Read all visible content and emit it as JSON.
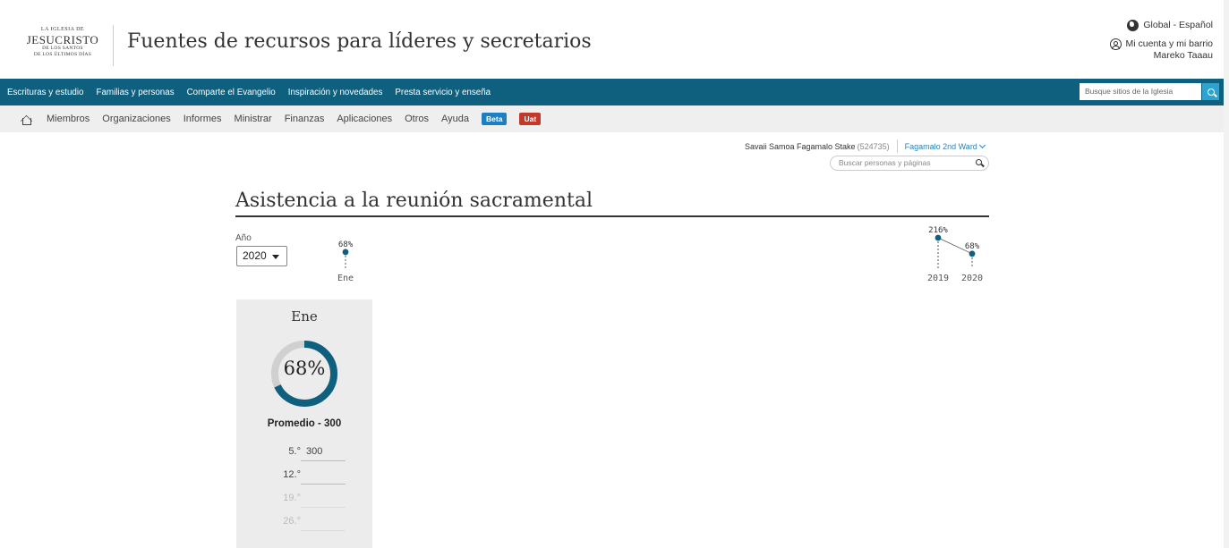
{
  "header": {
    "logo_lines": [
      "LA IGLESIA DE",
      "JESUCRISTO",
      "DE LOS SANTOS",
      "DE LOS ÚLTIMOS DÍAS"
    ],
    "site_title": "Fuentes de recursos para líderes y secretarios",
    "language": "Global - Español",
    "account_label": "Mi cuenta y mi barrio",
    "user_name": "Mareko Taaau"
  },
  "main_nav": {
    "items": [
      "Escrituras y estudio",
      "Familias y personas",
      "Comparte el Evangelio",
      "Inspiración y novedades",
      "Presta servicio y enseña"
    ],
    "search_placeholder": "Busque sitios de la Iglesia"
  },
  "sub_nav": {
    "items": [
      "Miembros",
      "Organizaciones",
      "Informes",
      "Ministrar",
      "Finanzas",
      "Aplicaciones",
      "Otros",
      "Ayuda"
    ],
    "badges": [
      {
        "label": "Beta",
        "color": "#1c7fc4"
      },
      {
        "label": "Uat",
        "color": "#c0392b"
      }
    ]
  },
  "unit": {
    "stake": "Savaii Samoa Fagamalo Stake",
    "stake_number": "(524735)",
    "ward": "Fagamalo 2nd Ward"
  },
  "people_search": {
    "placeholder": "Buscar personas y páginas"
  },
  "page": {
    "title": "Asistencia a la reunión sacramental",
    "year_label": "Año",
    "year_value": "2020"
  },
  "chart_data": [
    {
      "type": "line",
      "categories": [
        "Ene"
      ],
      "values": [
        68
      ],
      "labels": [
        "68%"
      ]
    },
    {
      "type": "line",
      "categories": [
        "2019",
        "2020"
      ],
      "values": [
        216,
        68
      ],
      "labels": [
        "216%",
        "68%"
      ]
    }
  ],
  "card": {
    "month": "Ene",
    "percent": "68%",
    "percent_value": 68,
    "average": "Promedio - 300",
    "weeks": [
      {
        "label": "5.°",
        "value": "300"
      },
      {
        "label": "12.°",
        "value": ""
      },
      {
        "label": "19.°",
        "value": ""
      },
      {
        "label": "26.°",
        "value": ""
      }
    ],
    "ring_color": "#0f5f7e",
    "ring_track": "#d0d0d0"
  }
}
